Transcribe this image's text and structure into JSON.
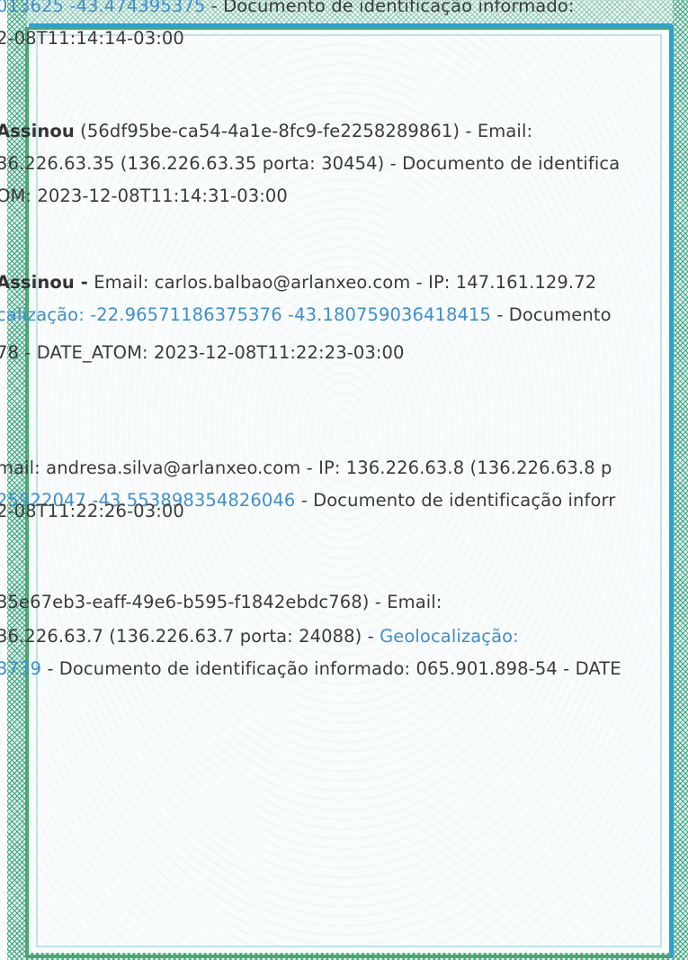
{
  "blocks": [
    {
      "lines": [
        [
          {
            "t": "013625 -43.474395375",
            "c": "link"
          },
          {
            "t": " - Documento de identificação informado:"
          }
        ],
        [
          {
            "t": "2-08T11:14:14-03:00"
          }
        ]
      ]
    },
    {
      "lines": [
        [
          {
            "t": "Assinou",
            "c": "bold"
          },
          {
            "t": " (56df95be-ca54-4a1e-8fc9-fe2258289861) - Email:"
          }
        ],
        [
          {
            "t": "36.226.63.35 (136.226.63.35 porta: 30454) - Documento de identifica"
          }
        ],
        [
          {
            "t": "OM: 2023-12-08T11:14:31-03:00"
          }
        ]
      ]
    },
    {
      "lines": [
        [
          {
            "t": "Assinou -",
            "c": "bold"
          },
          {
            "t": " Email: carlos.balbao@arlanxeo.com - IP: 147.161.129.72"
          }
        ],
        [
          {
            "t": "calização: -22.96571186375376 -43.180759036418415",
            "c": "link"
          },
          {
            "t": " - Documento"
          }
        ],
        [
          {
            "t": "78 - DATE_ATOM: 2023-12-08T11:22:23-03:00"
          }
        ]
      ]
    },
    {
      "lines": [
        [
          {
            "t": "mail: andresa.silva@arlanxeo.com - IP: 136.226.63.8 (136.226.63.8 p"
          }
        ],
        [
          {
            "t": "25922047 -43.553898354826046",
            "c": "link"
          },
          {
            "t": " - Documento de identificação inforr"
          }
        ],
        [
          {
            "t": "2-08T11:22:26-03:00"
          }
        ]
      ]
    },
    {
      "lines": [
        [
          {
            "t": "35e67eb3-eaff-49e6-b595-f1842ebdc768) - Email:"
          }
        ],
        [
          {
            "t": "36.226.63.7 (136.226.63.7 porta: 24088) - "
          },
          {
            "t": "Geolocalização:",
            "c": "link"
          }
        ],
        [
          {
            "t": "3739",
            "c": "link"
          },
          {
            "t": " - Documento de identificação informado: 065.901.898-54 - DATE"
          }
        ]
      ]
    }
  ]
}
